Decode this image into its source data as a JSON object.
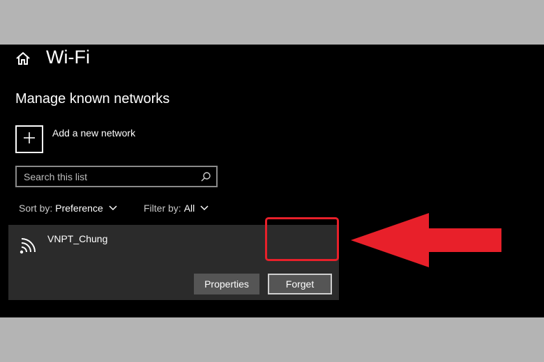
{
  "header": {
    "title": "Wi-Fi",
    "home_icon": "home-icon"
  },
  "section": {
    "title": "Manage known networks"
  },
  "add_network": {
    "label": "Add a new network",
    "icon": "plus-icon"
  },
  "search": {
    "placeholder": "Search this list",
    "value": "",
    "icon": "search-icon"
  },
  "sort": {
    "label": "Sort by:",
    "value": "Preference"
  },
  "filter": {
    "label": "Filter by:",
    "value": "All"
  },
  "network": {
    "name": "VNPT_Chung",
    "icon": "wifi-icon",
    "properties_label": "Properties",
    "forget_label": "Forget"
  },
  "annotation": {
    "highlight_color": "#e8202a",
    "arrow_color": "#e8202a"
  },
  "colors": {
    "background": "#000000",
    "card": "#2b2b2b",
    "button": "#555555",
    "frame": "#b4b4b4"
  }
}
